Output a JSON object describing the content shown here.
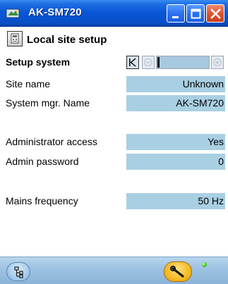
{
  "window": {
    "title": "AK-SM720",
    "icon": "ak-device-icon"
  },
  "titlebar_buttons": {
    "minimize_icon": "minimize-icon",
    "maximize_icon": "maximize-icon",
    "close_icon": "close-icon"
  },
  "header": {
    "title": "Local site setup",
    "icon": "site-setup-icon"
  },
  "section": {
    "label": "Setup system",
    "pager": {
      "first_icon": "first-page-icon",
      "prev_icon": "previous-page-icon",
      "next_icon": "next-page-icon",
      "position_fraction": 0.0
    }
  },
  "fields": [
    {
      "label": "Site name",
      "value": "Unknown"
    },
    {
      "label": "System mgr. Name",
      "value": "AK-SM720"
    },
    {
      "label": "Administrator access",
      "value": "Yes"
    },
    {
      "label": "Admin password",
      "value": "0"
    },
    {
      "label": "Mains frequency",
      "value": "50 Hz"
    }
  ],
  "bottombar": {
    "nav_icon": "network-tree-icon",
    "tool_icon": "wrench-icon",
    "status_icon": "status-led-icon",
    "status_color": "#3bbf1e"
  },
  "colors": {
    "title_bar": "#0852cf",
    "value_field": "#a9cfe3",
    "bottom_bar": "#9fc3e2"
  }
}
